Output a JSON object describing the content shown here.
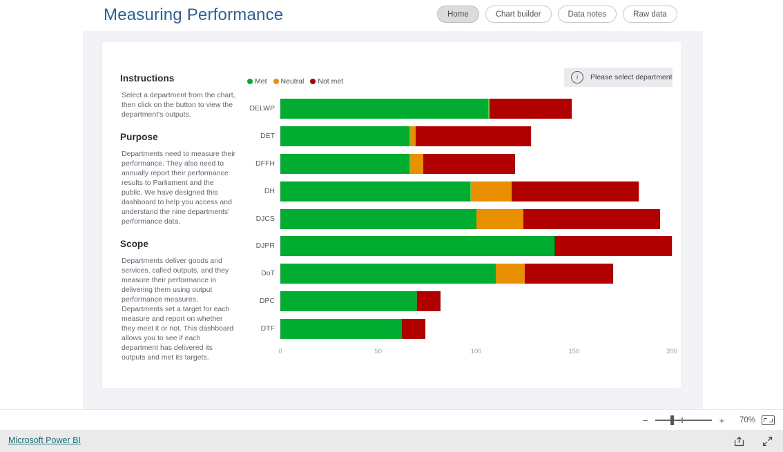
{
  "header": {
    "title": "Measuring Performance",
    "title_color": "#2d5f9a",
    "nav": [
      {
        "label": "Home",
        "active": true
      },
      {
        "label": "Chart builder",
        "active": false
      },
      {
        "label": "Data notes",
        "active": false
      },
      {
        "label": "Raw data",
        "active": false
      }
    ]
  },
  "sidebar": {
    "sections": [
      {
        "heading": "Instructions",
        "body": "Select a department from the chart, then click on the button to view the department's outputs."
      },
      {
        "heading": "Purpose",
        "body": "Departments need to measure their performance. They also need to annually report their performance results to Parliament and the public. We have designed this dashboard to help you access and understand the nine departments' performance data."
      },
      {
        "heading": "Scope",
        "body": "Departments deliver goods and services, called outputs, and they measure their performance in delivering them using output performance measures. Departments set a target for each measure and report on whether they meet it or not. This dashboard allows you to see if each department has delivered its outputs and met its targets."
      }
    ]
  },
  "notice": {
    "icon": "info-icon",
    "glyph": "i",
    "text": "Please select department"
  },
  "chart_data": {
    "type": "bar",
    "orientation": "horizontal",
    "stacked": true,
    "title": "",
    "xlabel": "",
    "ylabel": "",
    "xlim": [
      0,
      200
    ],
    "xticks": [
      0,
      50,
      100,
      150,
      200
    ],
    "grid": false,
    "legend_position": "top-left",
    "categories": [
      "DELWP",
      "DET",
      "DFFH",
      "DH",
      "DJCS",
      "DJPR",
      "DoT",
      "DPC",
      "DTF"
    ],
    "series": [
      {
        "name": "Met",
        "color": "#00ad31",
        "values": [
          106,
          66,
          66,
          97,
          100,
          140,
          110,
          70,
          62
        ]
      },
      {
        "name": "Neutral",
        "color": "#e99000",
        "values": [
          1,
          3,
          7,
          21,
          24,
          0,
          15,
          0,
          0
        ]
      },
      {
        "name": "Not met",
        "color": "#b00000",
        "values": [
          42,
          59,
          47,
          65,
          70,
          60,
          45,
          12,
          12
        ]
      }
    ]
  },
  "statusbar": {
    "zoom_out": "−",
    "zoom_in": "+",
    "zoom_level": "70%",
    "fit_icon": "fit-to-page-icon"
  },
  "footer": {
    "brand": "Microsoft Power BI",
    "icons": [
      "share-icon",
      "fullscreen-icon"
    ]
  }
}
